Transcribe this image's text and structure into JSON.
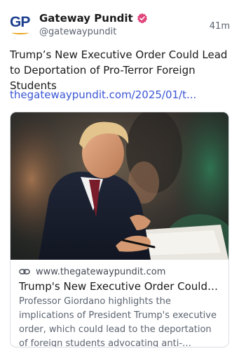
{
  "post": {
    "author_name": "Gateway Pundit",
    "handle": "@gatewaypundit",
    "time_ago": "41m",
    "avatar_text": "GP",
    "text": "Trump’s New Executive Order Could Lead to Deportation of Pro-Terror Foreign Students",
    "link": "thegatewaypundit.com/2025/01/t..."
  },
  "card": {
    "domain": "www.thegatewaypundit.com",
    "title": "Trump's New Executive Order Could L...",
    "description": "Professor Giordano highlights the implications of President Trump's executive order, which could lead to the deportation of foreign students advocating anti-American ..."
  },
  "colors": {
    "link": "#3a56d4",
    "verified": "#e0457b",
    "brand_blue": "#1d3f8f",
    "brand_gold": "#e8a317"
  },
  "icons": {
    "verified": "verified-badge-icon",
    "link": "link-icon"
  }
}
